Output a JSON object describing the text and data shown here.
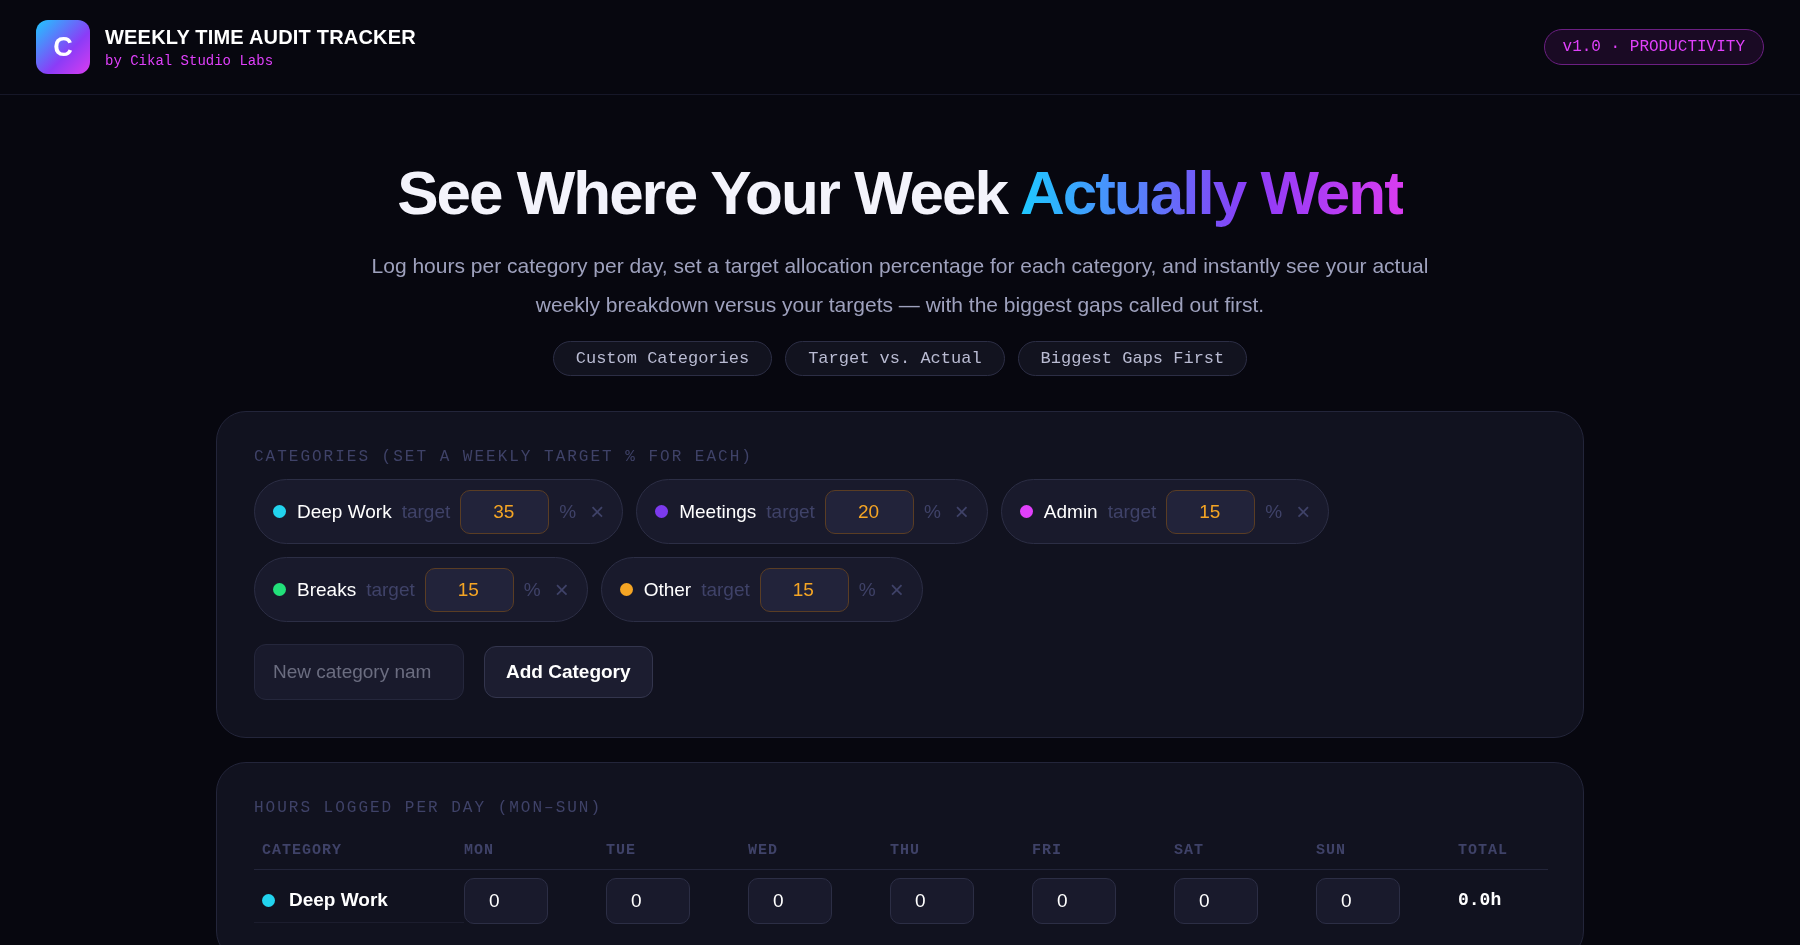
{
  "header": {
    "logo_letter": "C",
    "title": "WEEKLY TIME AUDIT TRACKER",
    "subtitle": "by Cikal Studio Labs",
    "badge": "v1.0 · PRODUCTIVITY"
  },
  "hero": {
    "title": "See Where Your Week",
    "title_highlight": "Actually Went",
    "description": "Log hours per category per day, set a target allocation percentage for each category, and instantly see your actual weekly breakdown versus your targets — with the biggest gaps called out first.",
    "tags": [
      "Custom Categories",
      "Target vs. Actual",
      "Biggest Gaps First"
    ]
  },
  "categories_panel": {
    "heading": "CATEGORIES (SET A WEEKLY TARGET % FOR EACH)",
    "categories": [
      {
        "name": "Deep Work",
        "color": "#22d3ee",
        "target_label": "target",
        "target": "35",
        "percent_sign": "%",
        "remove_glyph": "×"
      },
      {
        "name": "Meetings",
        "color": "#7c3aed",
        "target_label": "target",
        "target": "20",
        "percent_sign": "%",
        "remove_glyph": "×"
      },
      {
        "name": "Admin",
        "color": "#e040fb",
        "target_label": "target",
        "target": "15",
        "percent_sign": "%",
        "remove_glyph": "×"
      },
      {
        "name": "Breaks",
        "color": "#22e07a",
        "target_label": "target",
        "target": "15",
        "percent_sign": "%",
        "remove_glyph": "×"
      },
      {
        "name": "Other",
        "color": "#f5a524",
        "target_label": "target",
        "target": "15",
        "percent_sign": "%",
        "remove_glyph": "×"
      }
    ],
    "new_category": {
      "placeholder": "New category nam"
    },
    "add_button": "Add Category"
  },
  "hours_panel": {
    "heading": "HOURS LOGGED PER DAY (MON–SUN)",
    "columns": [
      "CATEGORY",
      "MON",
      "TUE",
      "WED",
      "THU",
      "FRI",
      "SAT",
      "SUN",
      "TOTAL"
    ],
    "rows": [
      {
        "name": "Deep Work",
        "color": "#22d3ee",
        "hours": [
          "0",
          "0",
          "0",
          "0",
          "0",
          "0",
          "0"
        ],
        "total": "0.0h"
      }
    ]
  }
}
